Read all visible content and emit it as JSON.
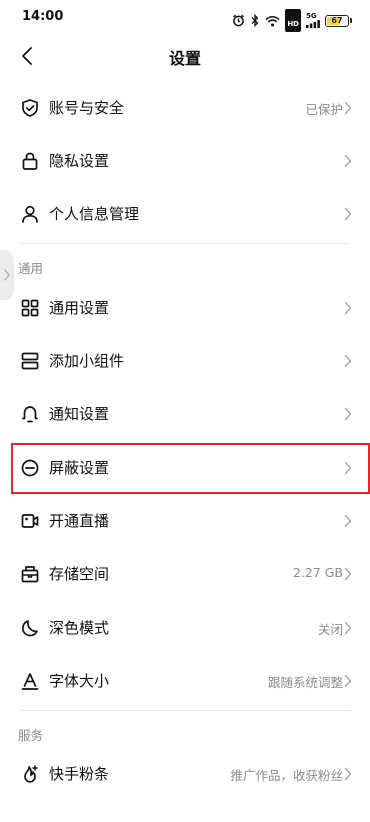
{
  "status_bar": {
    "time": "14:00",
    "network_label": "5G",
    "hd_label": "HD",
    "battery_level": "67"
  },
  "nav": {
    "title": "设置"
  },
  "rows": [
    {
      "id": "account",
      "label": "账号与安全",
      "value": "已保护",
      "icon": "shield-check-icon"
    },
    {
      "id": "privacy",
      "label": "隐私设置",
      "value": "",
      "icon": "lock-icon"
    },
    {
      "id": "personal",
      "label": "个人信息管理",
      "value": "",
      "icon": "person-icon"
    },
    {
      "id": "general",
      "label": "通用设置",
      "value": "",
      "icon": "grid-icon"
    },
    {
      "id": "widget",
      "label": "添加小组件",
      "value": "",
      "icon": "widget-icon"
    },
    {
      "id": "notify",
      "label": "通知设置",
      "value": "",
      "icon": "bell-icon"
    },
    {
      "id": "block",
      "label": "屏蔽设置",
      "value": "",
      "icon": "block-icon"
    },
    {
      "id": "live",
      "label": "开通直播",
      "value": "",
      "icon": "video-icon"
    },
    {
      "id": "storage",
      "label": "存储空间",
      "value": "2.27 GB",
      "icon": "storage-box-icon"
    },
    {
      "id": "dark",
      "label": "深色模式",
      "value": "关闭",
      "icon": "moon-icon"
    },
    {
      "id": "font",
      "label": "字体大小",
      "value": "跟随系统调整",
      "icon": "font-icon"
    },
    {
      "id": "fans",
      "label": "快手粉条",
      "value": "推广作品，收获粉丝",
      "icon": "fire-plus-icon"
    }
  ],
  "sections": {
    "general": "通用",
    "services": "服务"
  },
  "colors": {
    "highlight_border": "#e8262a",
    "battery_fill": "#f5d240",
    "secondary_text": "#8c8c8c"
  }
}
